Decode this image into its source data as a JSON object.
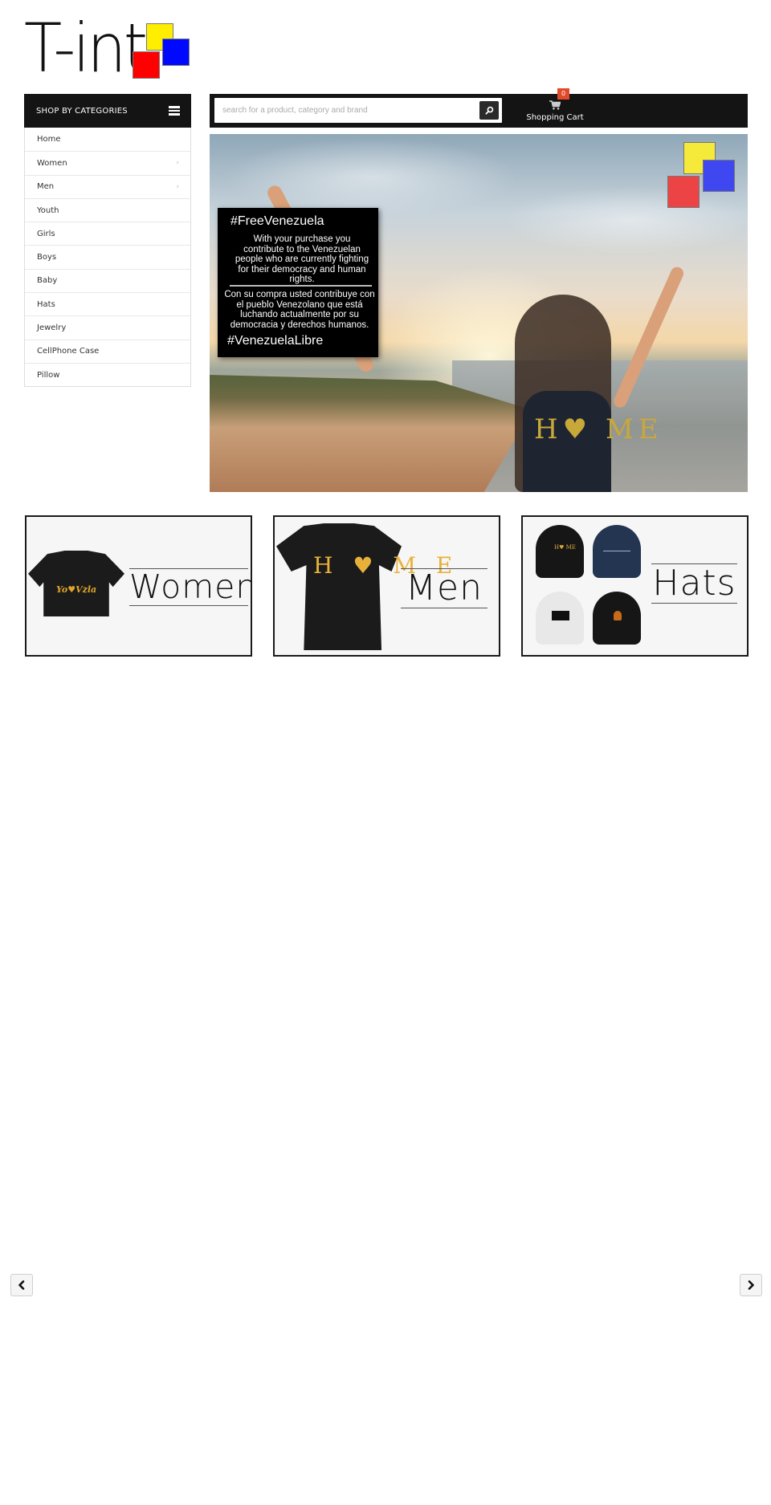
{
  "logo": {
    "text": "T-int",
    "colors": {
      "yellow": "#ffee00",
      "blue": "#0008ff",
      "red": "#ff0000"
    }
  },
  "sidebar": {
    "title": "SHOP BY CATEGORIES",
    "menu_icon": "hamburger-icon",
    "items": [
      {
        "label": "Home",
        "has_submenu": false
      },
      {
        "label": "Women",
        "has_submenu": true
      },
      {
        "label": "Men",
        "has_submenu": true
      },
      {
        "label": "Youth",
        "has_submenu": false
      },
      {
        "label": "Girls",
        "has_submenu": false
      },
      {
        "label": "Boys",
        "has_submenu": false
      },
      {
        "label": "Baby",
        "has_submenu": false
      },
      {
        "label": "Hats",
        "has_submenu": false
      },
      {
        "label": "Jewelry",
        "has_submenu": false
      },
      {
        "label": "CellPhone Case",
        "has_submenu": false
      },
      {
        "label": "Pillow",
        "has_submenu": false
      }
    ],
    "chevron": "›"
  },
  "search": {
    "placeholder": "search for a product, category and brand",
    "value": "",
    "button_icon": "search-icon"
  },
  "cart": {
    "label": "Shopping Cart",
    "count": "0",
    "icon": "cart-icon",
    "badge_color": "#e04a2a"
  },
  "hero": {
    "title": "#FreeVenezuela",
    "text_en": "With your purchase you contribute to the Venezuelan people who are currently fighting for their democracy and human rights.",
    "text_es": "Con su compra usted contribuye con el pueblo Venezolano que está luchando actualmente por su democracia y derechos humanos.",
    "tagline": "#VenezuelaLibre",
    "shirt_text": "H♥ ME"
  },
  "categories": [
    {
      "label": "Women",
      "product_text": "Yo♥Vzla"
    },
    {
      "label": "Men",
      "product_text": "H ♥ M E"
    },
    {
      "label": "Hats",
      "product_text": "H♥ ME"
    }
  ],
  "carousel": {
    "prev_icon": "chevron-left-icon",
    "next_icon": "chevron-right-icon",
    "prev_glyph": "‹",
    "next_glyph": "›"
  }
}
